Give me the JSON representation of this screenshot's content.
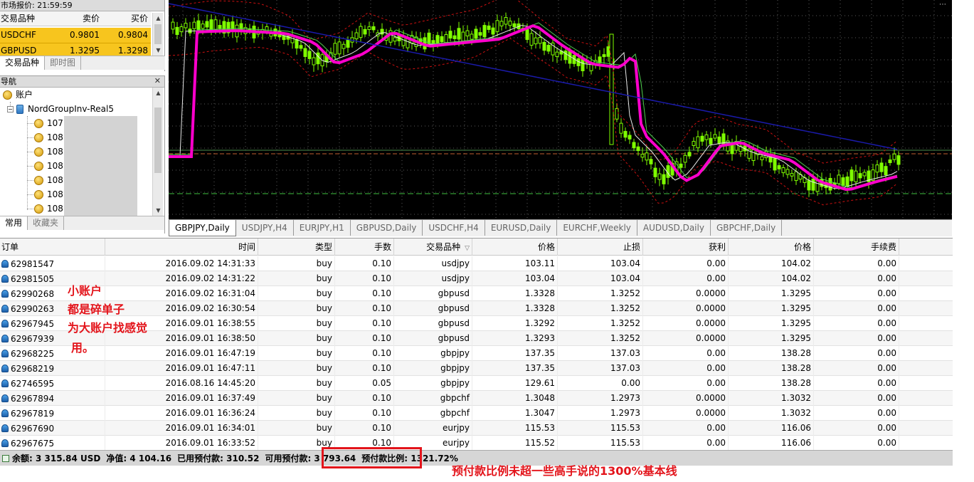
{
  "market_watch": {
    "title": "市场报价: 21:59:59",
    "columns": [
      "交易品种",
      "卖价",
      "买价"
    ],
    "rows": [
      {
        "symbol": "USDCHF",
        "bid": "0.9801",
        "ask": "0.9804"
      },
      {
        "symbol": "GBPUSD",
        "bid": "1.3295",
        "ask": "1.3298"
      }
    ],
    "tabs": [
      "交易品种",
      "即时图"
    ]
  },
  "navigator": {
    "title": "导航",
    "root": "账户",
    "server": "NordGroupInv-Real5",
    "accounts": [
      "107",
      "108",
      "108",
      "108",
      "108",
      "108",
      "108"
    ],
    "tabs": [
      "常用",
      "收藏夹"
    ]
  },
  "chart": {
    "background": "#000000",
    "candle_color": "#7fff00",
    "ma_color": "#ff00cc",
    "long_ma_color": "#1a1aaa",
    "band_color": "#cc1010"
  },
  "chart_tabs": [
    "GBPJPY,Daily",
    "USDJPY,H4",
    "EURJPY,H1",
    "GBPUSD,Daily",
    "USDCHF,H4",
    "EURUSD,Daily",
    "EURCHF,Weekly",
    "AUDUSD,Daily",
    "GBPCHF,Daily"
  ],
  "terminal": {
    "columns": [
      "订单",
      "时间",
      "类型",
      "手数",
      "交易品种",
      "价格",
      "止损",
      "获利",
      "价格",
      "手续费"
    ],
    "rows": [
      [
        "62981547",
        "2016.09.02 14:31:33",
        "buy",
        "0.10",
        "usdjpy",
        "103.11",
        "103.04",
        "0.00",
        "104.02",
        "0.00"
      ],
      [
        "62981505",
        "2016.09.02 14:31:22",
        "buy",
        "0.10",
        "usdjpy",
        "103.04",
        "103.04",
        "0.00",
        "104.02",
        "0.00"
      ],
      [
        "62990268",
        "2016.09.02 16:31:04",
        "buy",
        "0.10",
        "gbpusd",
        "1.3328",
        "1.3252",
        "0.0000",
        "1.3295",
        "0.00"
      ],
      [
        "62990263",
        "2016.09.02 16:30:54",
        "buy",
        "0.10",
        "gbpusd",
        "1.3328",
        "1.3252",
        "0.0000",
        "1.3295",
        "0.00"
      ],
      [
        "62967945",
        "2016.09.01 16:38:55",
        "buy",
        "0.10",
        "gbpusd",
        "1.3292",
        "1.3252",
        "0.0000",
        "1.3295",
        "0.00"
      ],
      [
        "62967939",
        "2016.09.01 16:38:50",
        "buy",
        "0.10",
        "gbpusd",
        "1.3293",
        "1.3252",
        "0.0000",
        "1.3295",
        "0.00"
      ],
      [
        "62968225",
        "2016.09.01 16:47:19",
        "buy",
        "0.10",
        "gbpjpy",
        "137.35",
        "137.03",
        "0.00",
        "138.28",
        "0.00"
      ],
      [
        "62968219",
        "2016.09.01 16:47:11",
        "buy",
        "0.10",
        "gbpjpy",
        "137.35",
        "137.03",
        "0.00",
        "138.28",
        "0.00"
      ],
      [
        "62746595",
        "2016.08.16 14:45:20",
        "buy",
        "0.05",
        "gbpjpy",
        "129.61",
        "0.00",
        "0.00",
        "138.28",
        "0.00"
      ],
      [
        "62967894",
        "2016.09.01 16:37:49",
        "buy",
        "0.10",
        "gbpchf",
        "1.3048",
        "1.2973",
        "0.0000",
        "1.3032",
        "0.00"
      ],
      [
        "62967819",
        "2016.09.01 16:36:24",
        "buy",
        "0.10",
        "gbpchf",
        "1.3047",
        "1.2973",
        "0.0000",
        "1.3032",
        "0.00"
      ],
      [
        "62967690",
        "2016.09.01 16:34:01",
        "buy",
        "0.10",
        "eurjpy",
        "115.53",
        "115.53",
        "0.00",
        "116.06",
        "0.00"
      ],
      [
        "62967675",
        "2016.09.01 16:33:52",
        "buy",
        "0.10",
        "eurjpy",
        "115.52",
        "115.53",
        "0.00",
        "116.06",
        "0.00"
      ]
    ]
  },
  "status": {
    "balance": "余额: 3 315.84 USD",
    "equity": "净值: 4 104.16",
    "margin": "已用预付款: 310.52",
    "free_margin": "可用预付款: 3 793.64",
    "margin_level": "预付款比例: 1321.72%"
  },
  "annotations": {
    "note_lines": [
      "小账户",
      "都是碎单子",
      "为大账户找感觉",
      "用。"
    ],
    "bottom_note": "预付款比例未超一些高手说的1300%基本线",
    "color": "#e3141b"
  }
}
